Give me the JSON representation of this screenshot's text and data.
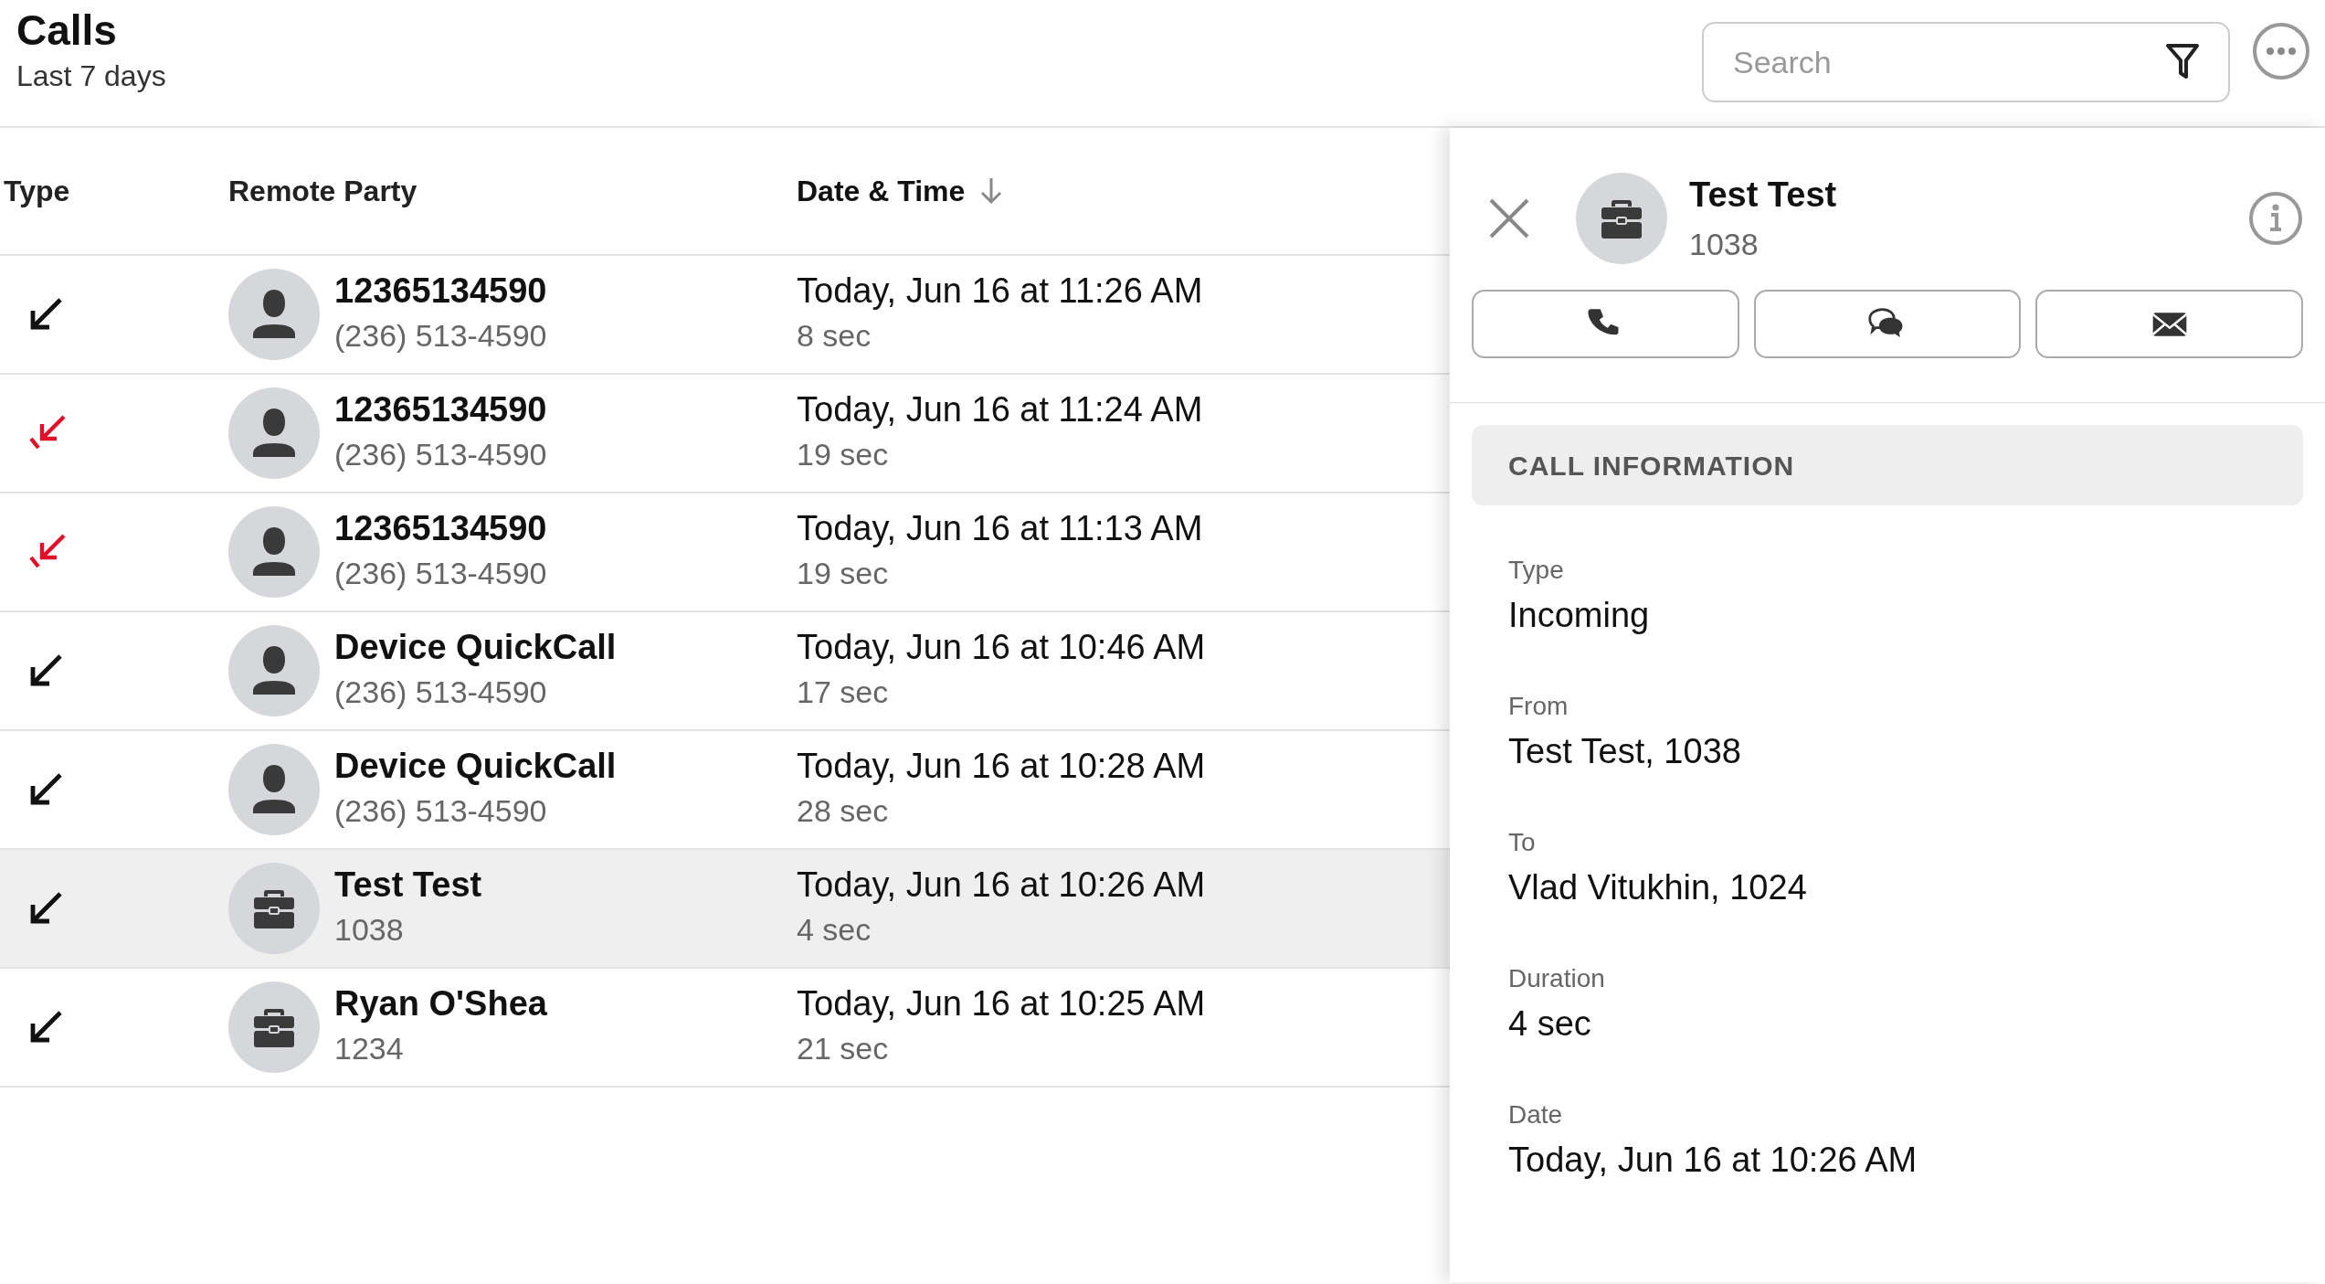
{
  "header": {
    "title": "Calls",
    "subtitle": "Last 7 days"
  },
  "search": {
    "placeholder": "Search"
  },
  "table": {
    "columns": [
      {
        "label": "Type",
        "sorted": false
      },
      {
        "label": "Remote Party",
        "sorted": false
      },
      {
        "label": "Date & Time",
        "sorted": true
      }
    ],
    "rows": [
      {
        "kind": "incoming",
        "avatar": {
          "kind": "person"
        },
        "name": "12365134590",
        "number": "(236) 513-4590",
        "datetime": "Today, Jun 16 at 11:26 AM",
        "duration": "8 sec",
        "selected": false
      },
      {
        "kind": "missed",
        "avatar": {
          "kind": "person"
        },
        "name": "12365134590",
        "number": "(236) 513-4590",
        "datetime": "Today, Jun 16 at 11:24 AM",
        "duration": "19 sec",
        "selected": false
      },
      {
        "kind": "missed",
        "avatar": {
          "kind": "person"
        },
        "name": "12365134590",
        "number": "(236) 513-4590",
        "datetime": "Today, Jun 16 at 11:13 AM",
        "duration": "19 sec",
        "selected": false
      },
      {
        "kind": "incoming",
        "avatar": {
          "kind": "person"
        },
        "name": "Device QuickCall",
        "number": "(236) 513-4590",
        "datetime": "Today, Jun 16 at 10:46 AM",
        "duration": "17 sec",
        "selected": false
      },
      {
        "kind": "incoming",
        "avatar": {
          "kind": "person"
        },
        "name": "Device QuickCall",
        "number": "(236) 513-4590",
        "datetime": "Today, Jun 16 at 10:28 AM",
        "duration": "28 sec",
        "selected": false
      },
      {
        "kind": "incoming",
        "avatar": {
          "kind": "business"
        },
        "name": "Test Test",
        "number": "1038",
        "datetime": "Today, Jun 16 at 10:26 AM",
        "duration": "4 sec",
        "selected": true
      },
      {
        "kind": "incoming",
        "avatar": {
          "kind": "business"
        },
        "name": "Ryan O'Shea",
        "number": "1234",
        "datetime": "Today, Jun 16 at 10:25 AM",
        "duration": "21 sec",
        "selected": false
      }
    ]
  },
  "detail": {
    "avatar": {
      "kind": "business"
    },
    "name": "Test Test",
    "number": "1038",
    "section": "CALL INFORMATION",
    "fields": [
      {
        "label": "Type",
        "value": "Incoming"
      },
      {
        "label": "From",
        "value": "Test Test, 1038"
      },
      {
        "label": "To",
        "value": "Vlad Vitukhin, 1024"
      },
      {
        "label": "Duration",
        "value": "4 sec"
      },
      {
        "label": "Date",
        "value": "Today, Jun 16 at 10:26 AM"
      }
    ]
  }
}
